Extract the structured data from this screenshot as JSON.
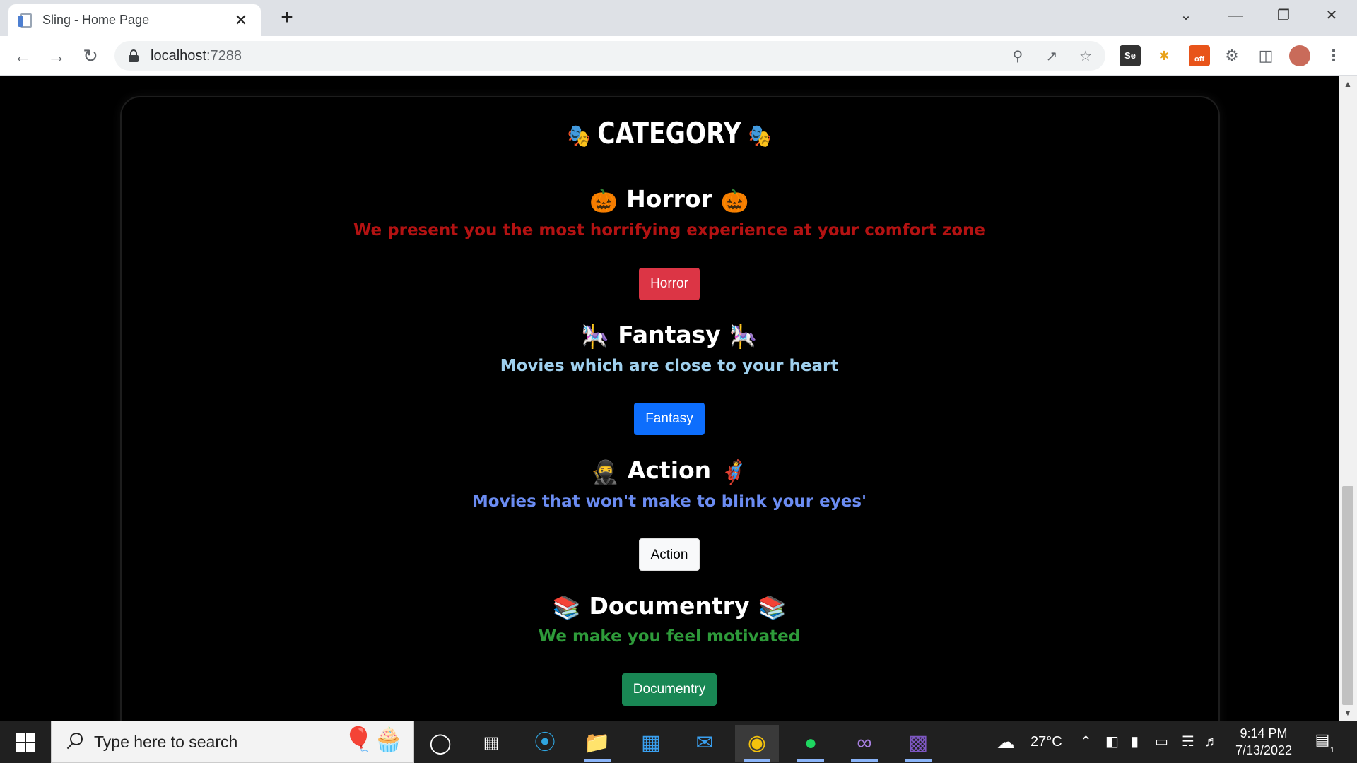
{
  "browser": {
    "tab_title": "Sling - Home Page",
    "tab_close": "✕",
    "new_tab": "+",
    "url_host": "localhost",
    "url_port": ":7288",
    "ext_selenium": "Se",
    "ext_off_badge": "off"
  },
  "page": {
    "category_emoji": "🎭",
    "category_title": "CATEGORY",
    "sections": [
      {
        "emoji": "🎃",
        "title": "Horror",
        "subtitle": "We present you the most horrifying experience at your comfort zone",
        "subtitle_color": "#b31212",
        "button": "Horror",
        "button_color": "#dc3545"
      },
      {
        "emoji": "🎠",
        "title": "Fantasy",
        "subtitle": "Movies which are close to your heart",
        "subtitle_color": "#9fd0ee",
        "button": "Fantasy",
        "button_color": "#0d6efd"
      },
      {
        "emoji_left": "🥷",
        "emoji_right": "🦸",
        "title": "Action",
        "subtitle": "Movies that won't make to blink your eyes'",
        "subtitle_color": "#6b8cf2",
        "button": "Action",
        "button_color": "#f8f9fa"
      },
      {
        "emoji": "📚",
        "title": "Documentry",
        "subtitle": "We make you feel motivated",
        "subtitle_color": "#2e9b3a",
        "button": "Documentry",
        "button_color": "#198754"
      }
    ]
  },
  "taskbar": {
    "search_placeholder": "Type here to search",
    "weather_temp": "27°C",
    "time": "9:14 PM",
    "date": "7/13/2022",
    "notification_count": "1"
  }
}
